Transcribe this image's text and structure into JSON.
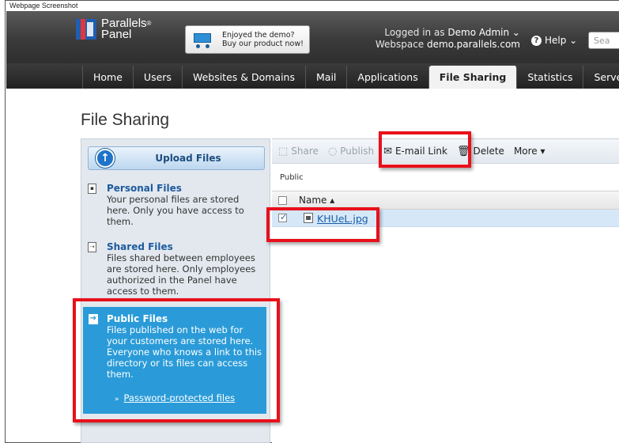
{
  "caption": "Webpage Screenshot",
  "brand": {
    "name": "Parallels",
    "sub": "Panel",
    "reg": "®"
  },
  "promo": {
    "line1": "Enjoyed the demo?",
    "line2": "Buy our product now!"
  },
  "user": {
    "logged_label": "Logged in as",
    "name": "Demo Admin ⌄",
    "webspace_label": "Webspace",
    "webspace": "demo.parallels.com"
  },
  "help": {
    "label": "Help ⌄",
    "icon": "?"
  },
  "search": {
    "placeholder": "Sea"
  },
  "nav": {
    "tabs": [
      "Home",
      "Users",
      "Websites & Domains",
      "Mail",
      "Applications",
      "File Sharing",
      "Statistics",
      "Serve"
    ]
  },
  "page": {
    "title": "File Sharing"
  },
  "sidebar": {
    "upload_label": "Upload Files",
    "personal": {
      "title": "Personal Files",
      "desc": [
        "Your personal files are stored",
        "here. Only you have access to",
        "them."
      ]
    },
    "shared": {
      "title": "Shared Files",
      "desc": [
        "Files shared between employees",
        "are stored here. Only employees",
        "authorized in the Panel have",
        "access to them."
      ]
    },
    "public": {
      "title": "Public Files",
      "desc": [
        "Files published on the web for",
        "your customers are stored here.",
        "Everyone who knows a link to this",
        "directory or its files can access",
        "them."
      ],
      "link": "Password-protected files"
    }
  },
  "toolbar": {
    "share": "Share",
    "publish": "Publish",
    "email": "E-mail Link",
    "delete": "Delete",
    "more": "More ▾"
  },
  "main": {
    "breadcrumb": "Public",
    "column_name": "Name ▴",
    "files": [
      {
        "name": "KHUeL.jpg",
        "checked": true
      }
    ]
  },
  "colors": {
    "highlight": "#e8101b",
    "public_bg": "#2a9bd8",
    "nav_bg": "#2f2f2f"
  }
}
